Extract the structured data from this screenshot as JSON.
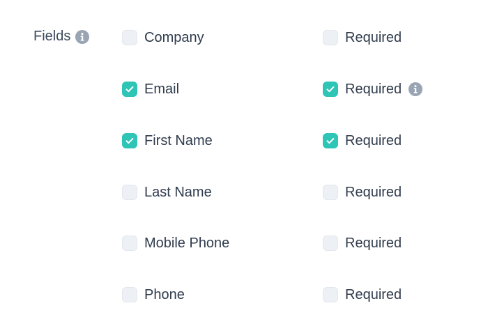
{
  "section": {
    "label": "Fields",
    "info_icon": "info-icon"
  },
  "colors": {
    "checked": "#2ec4b6",
    "unchecked": "#edf1f5",
    "info_icon": "#9aa5b4",
    "text": "#2f3b4c"
  },
  "rows": [
    {
      "field_label": "Company",
      "field_checked": false,
      "required_label": "Required",
      "required_checked": false,
      "required_info": false
    },
    {
      "field_label": "Email",
      "field_checked": true,
      "required_label": "Required",
      "required_checked": true,
      "required_info": true
    },
    {
      "field_label": "First Name",
      "field_checked": true,
      "required_label": "Required",
      "required_checked": true,
      "required_info": false
    },
    {
      "field_label": "Last Name",
      "field_checked": false,
      "required_label": "Required",
      "required_checked": false,
      "required_info": false
    },
    {
      "field_label": "Mobile Phone",
      "field_checked": false,
      "required_label": "Required",
      "required_checked": false,
      "required_info": false
    },
    {
      "field_label": "Phone",
      "field_checked": false,
      "required_label": "Required",
      "required_checked": false,
      "required_info": false
    }
  ]
}
